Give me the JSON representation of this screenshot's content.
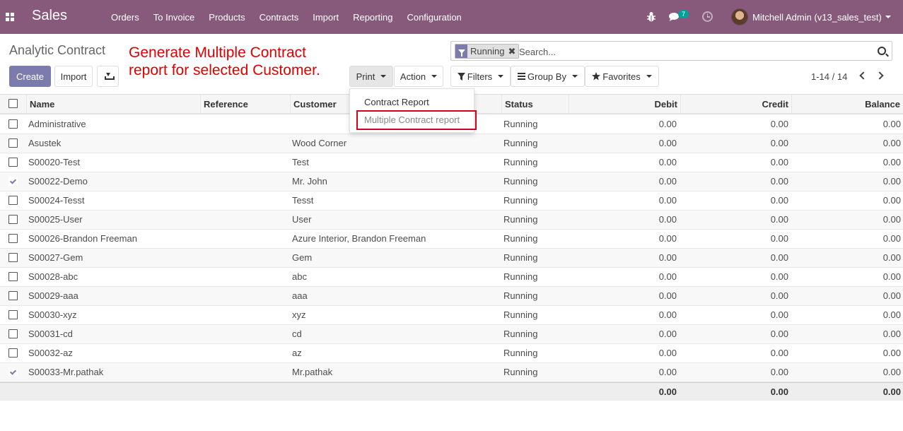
{
  "navbar": {
    "brand": "Sales",
    "menu": [
      "Orders",
      "To Invoice",
      "Products",
      "Contracts",
      "Import",
      "Reporting",
      "Configuration"
    ],
    "chat_count": "7",
    "user": "Mitchell Admin (v13_sales_test)",
    "bg_color": "#875a7b"
  },
  "control": {
    "breadcrumb": "Analytic Contract",
    "annotation": "Generate Multiple Contract\nreport for selected Customer.",
    "create": "Create",
    "import": "Import",
    "print": "Print",
    "action": "Action",
    "filters": "Filters",
    "group_by": "Group By",
    "favorites": "Favorites",
    "pager": "1-14 / 14"
  },
  "search": {
    "facet": "Running",
    "placeholder": "Search..."
  },
  "print_menu": {
    "items": [
      "Contract Report",
      "Multiple Contract report"
    ]
  },
  "table": {
    "headers": {
      "name": "Name",
      "reference": "Reference",
      "customer": "Customer",
      "status": "Status",
      "debit": "Debit",
      "credit": "Credit",
      "balance": "Balance"
    },
    "rows": [
      {
        "name": "Administrative",
        "customer": "",
        "status": "Running",
        "debit": "0.00",
        "credit": "0.00",
        "balance": "0.00",
        "checked": false
      },
      {
        "name": "Asustek",
        "customer": "Wood Corner",
        "status": "Running",
        "debit": "0.00",
        "credit": "0.00",
        "balance": "0.00",
        "checked": false
      },
      {
        "name": "S00020-Test",
        "customer": "Test",
        "status": "Running",
        "debit": "0.00",
        "credit": "0.00",
        "balance": "0.00",
        "checked": false
      },
      {
        "name": "S00022-Demo",
        "customer": "Mr. John",
        "status": "Running",
        "debit": "0.00",
        "credit": "0.00",
        "balance": "0.00",
        "checked": true
      },
      {
        "name": "S00024-Tesst",
        "customer": "Tesst",
        "status": "Running",
        "debit": "0.00",
        "credit": "0.00",
        "balance": "0.00",
        "checked": false
      },
      {
        "name": "S00025-User",
        "customer": "User",
        "status": "Running",
        "debit": "0.00",
        "credit": "0.00",
        "balance": "0.00",
        "checked": false
      },
      {
        "name": "S00026-Brandon Freeman",
        "customer": "Azure Interior, Brandon Freeman",
        "status": "Running",
        "debit": "0.00",
        "credit": "0.00",
        "balance": "0.00",
        "checked": false
      },
      {
        "name": "S00027-Gem",
        "customer": "Gem",
        "status": "Running",
        "debit": "0.00",
        "credit": "0.00",
        "balance": "0.00",
        "checked": false
      },
      {
        "name": "S00028-abc",
        "customer": "abc",
        "status": "Running",
        "debit": "0.00",
        "credit": "0.00",
        "balance": "0.00",
        "checked": false
      },
      {
        "name": "S00029-aaa",
        "customer": "aaa",
        "status": "Running",
        "debit": "0.00",
        "credit": "0.00",
        "balance": "0.00",
        "checked": false
      },
      {
        "name": "S00030-xyz",
        "customer": "xyz",
        "status": "Running",
        "debit": "0.00",
        "credit": "0.00",
        "balance": "0.00",
        "checked": false
      },
      {
        "name": "S00031-cd",
        "customer": "cd",
        "status": "Running",
        "debit": "0.00",
        "credit": "0.00",
        "balance": "0.00",
        "checked": false
      },
      {
        "name": "S00032-az",
        "customer": "az",
        "status": "Running",
        "debit": "0.00",
        "credit": "0.00",
        "balance": "0.00",
        "checked": false
      },
      {
        "name": "S00033-Mr.pathak",
        "customer": "Mr.pathak",
        "status": "Running",
        "debit": "0.00",
        "credit": "0.00",
        "balance": "0.00",
        "checked": true
      }
    ],
    "totals": {
      "debit": "0.00",
      "credit": "0.00",
      "balance": "0.00"
    }
  }
}
